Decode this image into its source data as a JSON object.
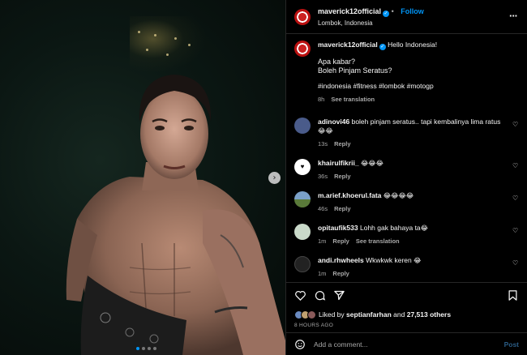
{
  "post": {
    "username": "maverick12official",
    "follow_label": "Follow",
    "location": "Lombok, Indonesia",
    "more_icon": "more-horizontal-icon",
    "caption": {
      "lead": "Hello Indonesia!",
      "line1": "Apa kabar?",
      "line2": "Boleh Pinjam Seratus?",
      "hashtags": "#indonesia #fitness #lombok #motogp",
      "time": "8h",
      "see_translation": "See translation"
    },
    "carousel": {
      "next_icon": "chevron-right-icon",
      "slide_count": 4,
      "active_slide": 1
    }
  },
  "comments": [
    {
      "username": "adinovi46",
      "text": "boleh pinjam seratus.. tapi kembalinya lima ratus",
      "emoji": "😂😂",
      "time": "13s",
      "reply": "Reply",
      "avatar_color": "#4a5b8a"
    },
    {
      "username": "khairulfikrii_",
      "text": "",
      "emoji": "😂😂😂",
      "time": "36s",
      "reply": "Reply",
      "avatar_color": "#ffffff"
    },
    {
      "username": "m.arief.khoerul.fata",
      "text": "",
      "emoji": "😂😂😂😂",
      "time": "46s",
      "reply": "Reply",
      "avatar_color": "#6c8a4a"
    },
    {
      "username": "opitaufik533",
      "text": "Lohh gak bahaya ta",
      "emoji": "😂",
      "time": "1m",
      "reply": "Reply",
      "see_translation": "See translation",
      "avatar_color": "#c9d9c9"
    },
    {
      "username": "andi.rhwheels",
      "text": "Wkwkwk keren",
      "emoji": "😂",
      "time": "1m",
      "reply": "Reply",
      "avatar_color": "#333333"
    }
  ],
  "actions": {
    "like_icon": "heart-icon",
    "comment_icon": "comment-icon",
    "share_icon": "share-icon",
    "save_icon": "bookmark-icon"
  },
  "likes": {
    "prefix": "Liked by",
    "user": "septianfarhan",
    "joiner": "and",
    "count": "27,513 others"
  },
  "timestamp": "8 HOURS AGO",
  "add_comment": {
    "placeholder": "Add a comment...",
    "post_label": "Post",
    "emoji_icon": "smile-icon"
  },
  "colors": {
    "accent": "#0095f6",
    "muted": "#a8a8a8",
    "background": "#000000"
  }
}
